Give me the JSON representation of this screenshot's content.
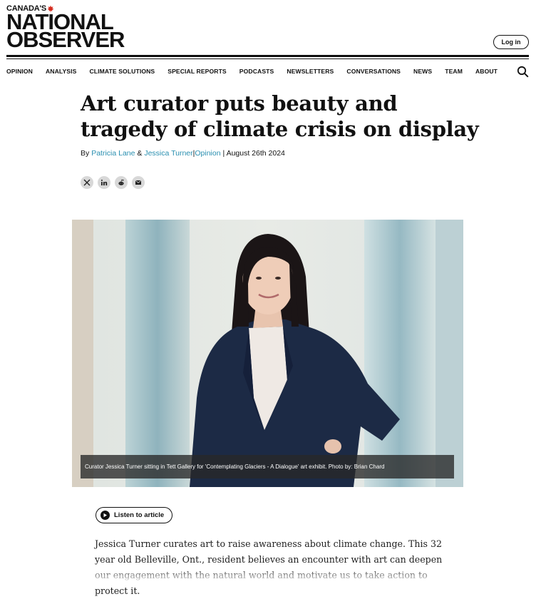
{
  "masthead": {
    "line1": "CANADA'S",
    "line2": "NATIONAL",
    "line3": "OBSERVER",
    "login_label": "Log in",
    "leaf_color": "#d52b1e"
  },
  "nav": {
    "items": [
      "OPINION",
      "ANALYSIS",
      "CLIMATE SOLUTIONS",
      "SPECIAL REPORTS",
      "PODCASTS",
      "NEWSLETTERS",
      "CONVERSATIONS",
      "NEWS",
      "TEAM",
      "ABOUT"
    ],
    "search_icon": "search-icon"
  },
  "article": {
    "title": "Art curator puts beauty and tragedy of climate crisis on display",
    "byline": {
      "prefix": "By",
      "author1": "Patricia Lane",
      "amp": "&",
      "author2": "Jessica Turner",
      "sep1": "|",
      "section": "Opinion",
      "sep2": "|",
      "date": "August 26th 2024"
    },
    "share_icons": [
      "x-icon",
      "linkedin-icon",
      "reddit-icon",
      "email-icon"
    ],
    "photo_caption": "Curator Jessica Turner sitting in Tett Gallery for 'Contemplating Glaciers - A Dialogue' art exhibit. Photo by: Brian Chard",
    "listen_label": "Listen to article",
    "body": "Jessica Turner curates art to raise awareness about climate change. This 32 year old Belleville, Ont., resident believes an encounter with art can deepen our engagement with the natural world and motivate us to take action to protect it."
  },
  "colors": {
    "link": "#2a8fb0",
    "share_bg": "#d8d8d8"
  }
}
